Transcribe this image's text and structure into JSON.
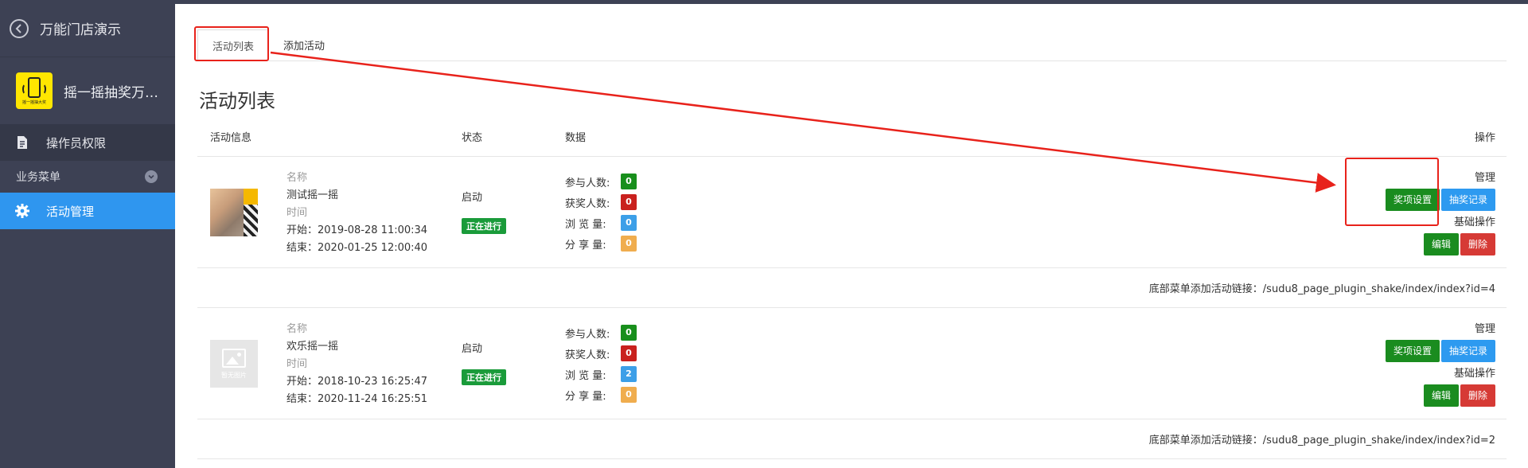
{
  "sidebar": {
    "title": "万能门店演示",
    "app_name": "摇一摇抽奖万能...",
    "app_logo_caption": "摇一摇抽大奖",
    "items": [
      {
        "label": "操作员权限"
      },
      {
        "label": "业务菜单"
      },
      {
        "label": "活动管理"
      }
    ]
  },
  "tabs": [
    {
      "label": "活动列表"
    },
    {
      "label": "添加活动"
    }
  ],
  "page_title": "活动列表",
  "table": {
    "headers": {
      "info": "活动信息",
      "status": "状态",
      "data": "数据",
      "ops": "操作"
    },
    "rows": [
      {
        "name_label": "名称",
        "name": "测试摇一摇",
        "time_label": "时间",
        "start": "开始：2019-08-28 11:00:34",
        "end": "结束：2020-01-25 12:00:40",
        "status_text": "启动",
        "status_badge": "正在进行",
        "participants_label": "参与人数:",
        "participants": "0",
        "winners_label": "获奖人数:",
        "winners": "0",
        "views_label": "浏 览 量:",
        "views": "0",
        "shares_label": "分 享 量:",
        "shares": "0",
        "manage_label": "管理",
        "prize_btn": "奖项设置",
        "record_btn": "抽奖记录",
        "basic_label": "基础操作",
        "edit_btn": "编辑",
        "delete_btn": "删除",
        "link": "底部菜单添加活动链接：/sudu8_page_plugin_shake/index/index?id=4"
      },
      {
        "name_label": "名称",
        "name": "欢乐摇一摇",
        "time_label": "时间",
        "start": "开始：2018-10-23 16:25:47",
        "end": "结束：2020-11-24 16:25:51",
        "status_text": "启动",
        "status_badge": "正在进行",
        "participants_label": "参与人数:",
        "participants": "0",
        "winners_label": "获奖人数:",
        "winners": "0",
        "views_label": "浏 览 量:",
        "views": "2",
        "shares_label": "分 享 量:",
        "shares": "0",
        "manage_label": "管理",
        "prize_btn": "奖项设置",
        "record_btn": "抽奖记录",
        "basic_label": "基础操作",
        "edit_btn": "编辑",
        "delete_btn": "删除",
        "link": "底部菜单添加活动链接：/sudu8_page_plugin_shake/index/index?id=2",
        "placeholder_caption": "暂无图片"
      }
    ]
  },
  "colors": {
    "sidebar_bg": "#3d4154",
    "active_item": "#2f96ef",
    "annotation": "#e8221b",
    "green": "#1a8c1f",
    "blue": "#2d9af0",
    "red": "#d63a35"
  }
}
